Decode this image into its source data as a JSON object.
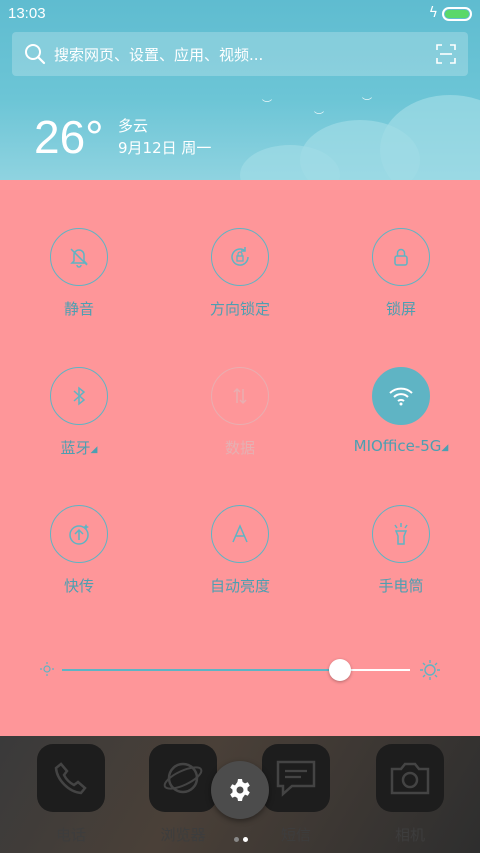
{
  "status": {
    "time": "13:03",
    "battery_level": 1.0
  },
  "search": {
    "placeholder": "搜索网页、设置、应用、视频..."
  },
  "weather": {
    "temperature": "26°",
    "condition": "多云",
    "date": "9月12日 周一"
  },
  "toggles": [
    {
      "label": "静音",
      "icon": "bell-off-icon",
      "state": "off"
    },
    {
      "label": "方向锁定",
      "icon": "rotation-lock-icon",
      "state": "off"
    },
    {
      "label": "锁屏",
      "icon": "lock-icon",
      "state": "off"
    },
    {
      "label": "蓝牙",
      "icon": "bluetooth-icon",
      "state": "off"
    },
    {
      "label": "数据",
      "icon": "mobile-data-icon",
      "state": "disabled"
    },
    {
      "label": "MIOffice-5G",
      "icon": "wifi-icon",
      "state": "on"
    },
    {
      "label": "快传",
      "icon": "quick-share-icon",
      "state": "off"
    },
    {
      "label": "自动亮度",
      "icon": "auto-brightness-icon",
      "state": "off"
    },
    {
      "label": "手电筒",
      "icon": "flashlight-icon",
      "state": "off"
    }
  ],
  "brightness": {
    "level": 0.8
  },
  "dock": {
    "apps": [
      {
        "name": "电话",
        "icon": "phone-icon"
      },
      {
        "name": "浏览器",
        "icon": "browser-icon"
      },
      {
        "name": "短信",
        "icon": "message-icon"
      },
      {
        "name": "相机",
        "icon": "camera-icon"
      }
    ]
  },
  "colors": {
    "panel": "#fe9699",
    "accent": "#5fb4c4",
    "sky": "#6cc5d6"
  }
}
